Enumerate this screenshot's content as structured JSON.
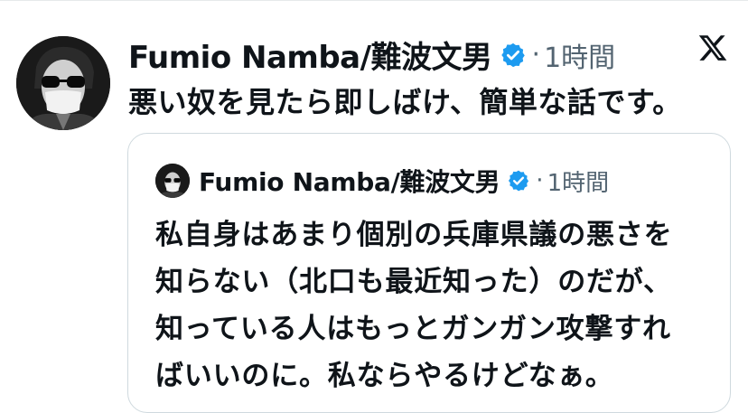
{
  "tweet": {
    "author_name": "Fumio Namba/難波文男",
    "separator": "·",
    "time": "1時間",
    "text": "悪い奴を見たら即しばけ、簡単な話です。",
    "avatar_icon": "profile-photo-avatar",
    "verified_icon": "verified-badge-icon",
    "platform_icon": "x-logo-icon"
  },
  "quote": {
    "author_name": "Fumio Namba/難波文男",
    "separator": "·",
    "time": "1時間",
    "lines": [
      "私自身はあまり個別の兵庫県議の悪さを",
      "知らない（北口も最近知った）のだが、",
      "知っている人はもっとガンガン攻撃すれ",
      "ばいいのに。私ならやるけどなぁ。"
    ]
  },
  "colors": {
    "text": "#0f1419",
    "muted": "#536471",
    "verified_blue": "#1d9bf0",
    "border": "#cfd9de"
  }
}
